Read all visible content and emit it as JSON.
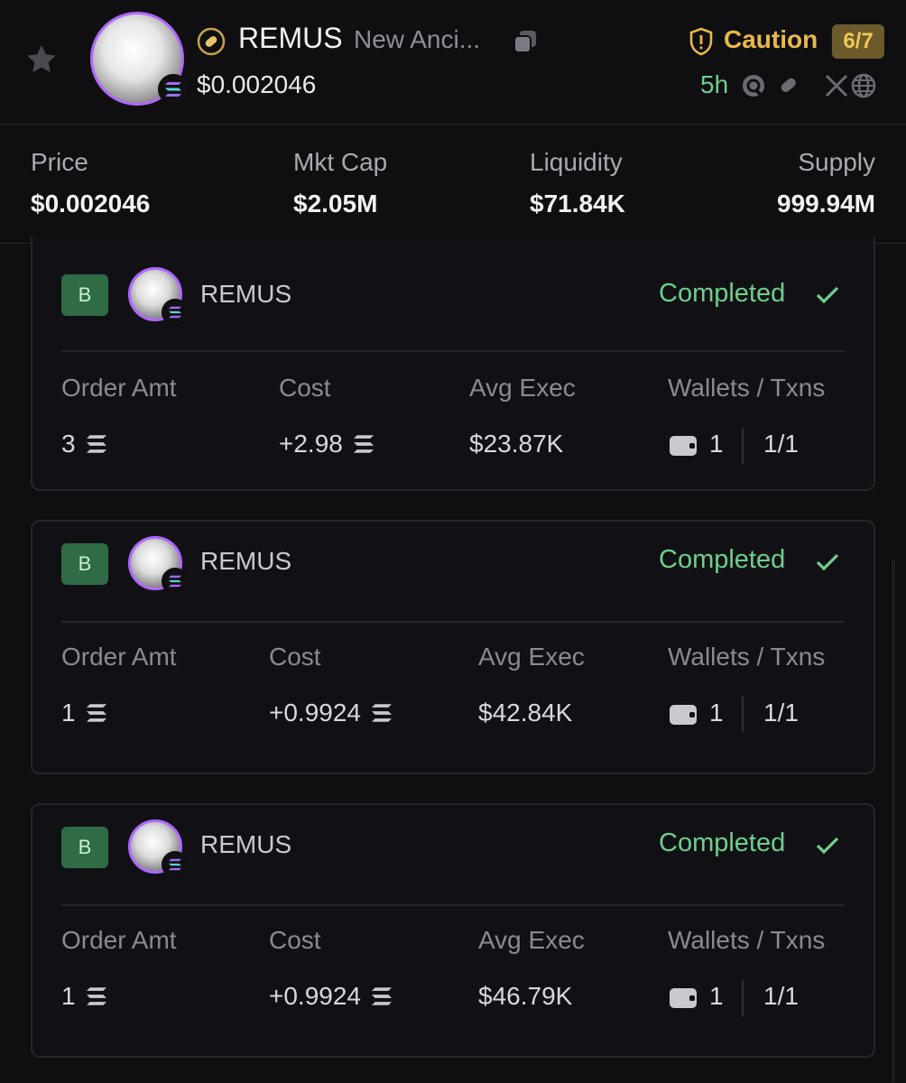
{
  "header": {
    "token_symbol": "REMUS",
    "token_name": "New Anci...",
    "price": "$0.002046",
    "risk_label": "Caution",
    "risk_score": "6/7",
    "age": "5h",
    "status_colors": {
      "caution": "#e9b949",
      "positive": "#6ecf8b",
      "avatar_ring": "#b068ff"
    }
  },
  "stats": [
    {
      "label": "Price",
      "value": "$0.002046"
    },
    {
      "label": "Mkt Cap",
      "value": "$2.05M"
    },
    {
      "label": "Liquidity",
      "value": "$71.84K"
    },
    {
      "label": "Supply",
      "value": "999.94M"
    }
  ],
  "columns": {
    "order_amt": "Order Amt",
    "cost": "Cost",
    "avg_exec": "Avg Exec",
    "wallets_txns": "Wallets / Txns"
  },
  "orders": [
    {
      "side": "B",
      "token": "REMUS",
      "status": "Completed",
      "order_amt": "3",
      "cost": "+2.98",
      "avg_exec": "$23.87K",
      "wallets": "1",
      "txns": "1/1"
    },
    {
      "side": "B",
      "token": "REMUS",
      "status": "Completed",
      "order_amt": "1",
      "cost": "+0.9924",
      "avg_exec": "$42.84K",
      "wallets": "1",
      "txns": "1/1"
    },
    {
      "side": "B",
      "token": "REMUS",
      "status": "Completed",
      "order_amt": "1",
      "cost": "+0.9924",
      "avg_exec": "$46.79K",
      "wallets": "1",
      "txns": "1/1"
    }
  ],
  "icons": [
    "star-icon",
    "pill-icon",
    "copy-icon",
    "shield-icon",
    "search-icon",
    "tag-icon",
    "x-icon",
    "globe-icon",
    "solana-icon",
    "check-icon",
    "wallet-icon"
  ]
}
